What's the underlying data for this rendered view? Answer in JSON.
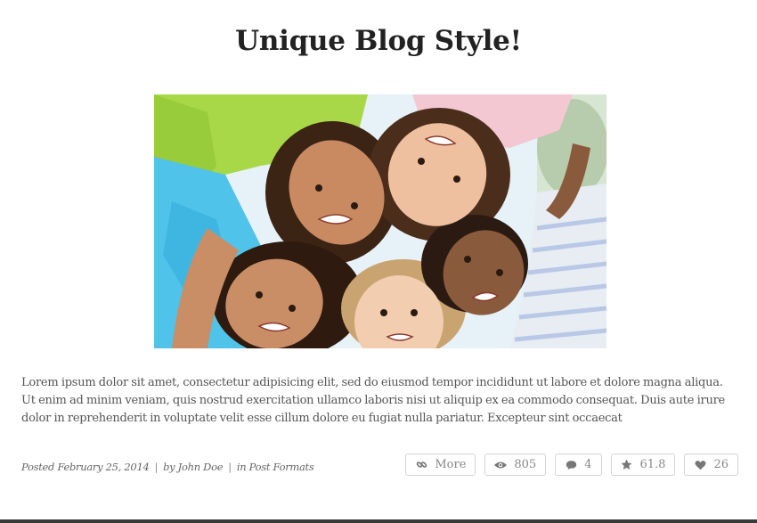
{
  "post": {
    "title": "Unique Blog Style!",
    "image_alt": "Children looking down into the camera in a circle",
    "excerpt": "Lorem ipsum dolor sit amet, consectetur adipisicing elit, sed do eiusmod tempor incididunt ut labore et dolore magna aliqua. Ut enim ad minim veniam, quis nostrud exercitation ullamco laboris nisi ut aliquip ex ea commodo consequat. Duis aute irure dolor in reprehenderit in voluptate velit esse cillum dolore eu fugiat nulla pariatur. Excepteur sint occaecat",
    "meta": {
      "posted": "Posted February 25, 2014",
      "separator": "|",
      "author": "by John Doe",
      "category": "in Post Formats"
    }
  },
  "actions": {
    "more": {
      "label": "More",
      "icon": "link-icon"
    },
    "views": {
      "value": "805",
      "icon": "eye-icon"
    },
    "comments": {
      "value": "4",
      "icon": "comment-icon"
    },
    "rating": {
      "value": "61.8",
      "icon": "star-icon"
    },
    "likes": {
      "value": "26",
      "icon": "heart-icon"
    }
  },
  "colors": {
    "title": "#222222",
    "text": "#555555",
    "icon": "#777777",
    "border": "#d4d4d4",
    "bottom_bar": "#3a3a3a"
  }
}
